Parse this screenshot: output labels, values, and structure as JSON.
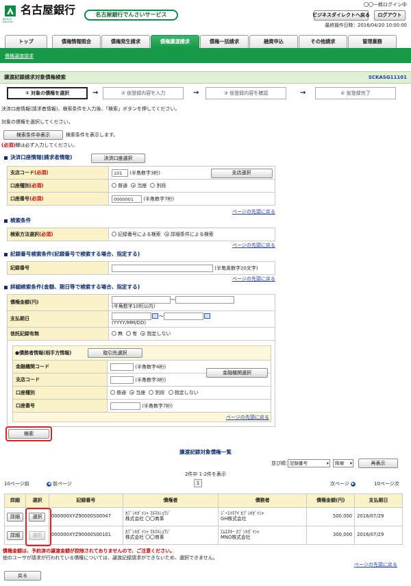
{
  "header": {
    "bank_name": "名古屋銀行",
    "logo_sub": "Bank of NAGOYA",
    "service_name": "名古屋銀行でんさいサービス",
    "user_login": "〇〇一郎ログイン中",
    "business_direct_back": "ビジネスダイレクトへ戻る",
    "logout": "ログアウト",
    "last_operation": "最終操作日時：2016/04/20 10:00:00"
  },
  "nav": {
    "top": "トップ",
    "tabs": [
      "債権情報照会",
      "債権発生請求",
      "債権譲渡請求",
      "債権一括請求",
      "融資申込",
      "その他請求",
      "管理業務"
    ],
    "active_index": 2,
    "subnav": "債権譲渡請求"
  },
  "page": {
    "title": "譲渡記録請求対象債権検索",
    "code": "SCKASG11101",
    "steps": [
      "① 対象の債権を選択",
      "② 仮登録内容を入力",
      "③ 仮登録内容を確認",
      "④ 仮登録完了"
    ],
    "arrow": "→",
    "instruction1": "決済口座情報(請求者情報)、検索条件を入力後、「検索」ボタンを押してください。",
    "instruction2": "対象の債権を選択してください。",
    "toggle_button": "検索条件非表示",
    "toggle_desc": "検索条件を表示します。",
    "required_note_mark": "(必須)",
    "required_note": "欄は必ず入力してください。"
  },
  "account_section": {
    "title": "決済口座情報(請求者情報)",
    "select_button": "決済口座選択",
    "branch_label": "支店コード",
    "required": "(必須)",
    "branch_value": "101",
    "branch_hint": "(半角数字3桁)",
    "branch_select": "支店選択",
    "type_label": "口座種別",
    "type_options": [
      "普通",
      "当座",
      "別段"
    ],
    "type_selected": 1,
    "number_label": "口座番号",
    "number_value": "0000001",
    "number_hint": "(半角数字7桁)",
    "page_top": "ページの先頭に戻る"
  },
  "search_section": {
    "title": "検索条件",
    "method_label": "検索方法選択",
    "required": "(必須)",
    "options": [
      "記録番号による検索",
      "詳細条件による検索"
    ],
    "selected": 1,
    "page_top": "ページの先頭に戻る"
  },
  "record_section": {
    "title": "記録番号検索条件(記録番号で検索する場合、指定する)",
    "label": "記録番号",
    "hint": "(半角英数字20文字)",
    "page_top": "ページの先頭に戻る"
  },
  "detail_section": {
    "title": "詳細検索条件(金額、期日等で検索する場合、指定する)",
    "amount_label": "債権金額(円)",
    "tilde": "～",
    "amount_hint": "(半角数字10桁以内)",
    "due_label": "支払期日",
    "due_hint": "(YYYY/MM/DD)",
    "trust_label": "信託記録有無",
    "trust_options": [
      "無",
      "有",
      "指定しない"
    ],
    "trust_selected": 2,
    "debtor_title": "●債務者情報(相手方情報)",
    "partner_select": "取引先選択",
    "fin_code_label": "金融機関コード",
    "fin_code_hint": "(半角数字4桁)",
    "fin_select": "金融機関選択",
    "branch_label": "支店コード",
    "branch_hint": "(半角数字3桁)",
    "type_label": "口座種別",
    "type_options": [
      "普通",
      "当座",
      "別段",
      "指定しない"
    ],
    "type_selected": 1,
    "number_label": "口座番号",
    "number_hint": "(半角数字7桁)",
    "page_top": "ページの先頭に戻る"
  },
  "search_button": "検索",
  "results": {
    "title": "譲渡記録対象債権一覧",
    "sort_label": "並び順：",
    "sort_field": "記録番号",
    "sort_order": "降順",
    "redisplay": "再表示",
    "count": "2件中 1-2件を表示",
    "prev_10": "10ページ前",
    "prev_page": "前ページ",
    "page_num": "1",
    "next_page": "次ページ",
    "next_10": "10ページ次",
    "headers": [
      "詳細",
      "選択",
      "記録番号",
      "債権者",
      "債務者",
      "債権金額(円)",
      "支払期日"
    ],
    "rows": [
      {
        "detail": "詳細",
        "select": "選択",
        "record": "000000XYZ90000S00047",
        "creditor1": "ｶﾌﾞｼｷｶﾞｲｼｬ ﾏﾙﾏﾙｼｮｳｼﾞ",
        "creditor2": "株式会社 〇〇商事",
        "debtor1": "ｼﾞｰｴｲﾁｱｲ ｶﾌﾞｼｷｶﾞｲｼｬ",
        "debtor2": "GH株式会社",
        "amount": "500,000",
        "due": "2016/07/29",
        "disabled": false
      },
      {
        "detail": "詳細",
        "select": "選択",
        "record": "000000XYZ90000S00101",
        "creditor1": "ｶﾌﾞｼｷｶﾞｲｼｬ ﾏﾙﾏﾙｼｮｳｼﾞ",
        "creditor2": "株式会社 〇〇商事",
        "debtor1": "ｴﾑｴﾇｵｰ ｶﾌﾞｼｷｶﾞｲｼｬ",
        "debtor2": "MNO株式会社",
        "amount": "300,000",
        "due": "2016/07/29",
        "disabled": true
      }
    ],
    "warning": "債権金額は、予約済の譲渡金額が控除されておりませんので、ご注意ください。",
    "note": "他のユーザが請求が行われている債権については、譲渡記録請求ができないため、選択できません。",
    "page_top": "ページの先頭に戻る"
  },
  "back_button": "戻る"
}
